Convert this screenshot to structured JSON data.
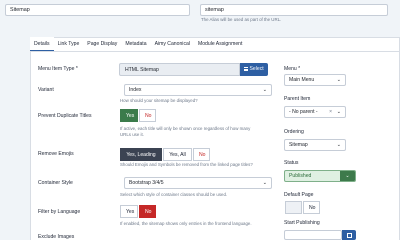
{
  "header": {
    "title_value": "Sitemap",
    "alias_value": "sitemap",
    "alias_note": "The Alias will be used as part of the URL."
  },
  "tabs": [
    "Details",
    "Link Type",
    "Page Display",
    "Metadata",
    "Aimy Canonical",
    "Module Assignment"
  ],
  "fields": {
    "menu_item_type": {
      "label": "Menu Item Type *",
      "value": "HTML Sitemap",
      "button": "Select"
    },
    "variant": {
      "label": "Variant",
      "value": "Index",
      "hint": "How should your sitemap be displayed?"
    },
    "prevent_duplicate": {
      "label": "Prevent Duplicate Titles",
      "yes": "Yes",
      "no": "No",
      "hint": "If active, each title will only be shown once regardless of how many URLs use it."
    },
    "remove_emojis": {
      "label": "Remove Emojis",
      "opt1": "Yes, Leading",
      "opt2": "Yes, All",
      "opt3": "No",
      "hint": "Should Emojis and Symbols be removed from the linked page titles?"
    },
    "container_style": {
      "label": "Container Style",
      "value": "Bootstrap 3/4/5",
      "hint": "Select which style of container classes should be used."
    },
    "filter_language": {
      "label": "Filter by Language",
      "yes": "Yes",
      "no": "No",
      "hint": "If enabled, the sitemap shows only entries in the frontend language."
    },
    "exclude_images": {
      "label": "Exclude Images"
    }
  },
  "sidebar": {
    "menu": {
      "label": "Menu *",
      "value": "Main Menu"
    },
    "parent_item": {
      "label": "Parent Item",
      "value": "- No parent -"
    },
    "ordering": {
      "label": "Ordering",
      "value": "Sitemap"
    },
    "status": {
      "label": "Status",
      "value": "Published"
    },
    "default_page": {
      "label": "Default Page",
      "value": "No"
    },
    "start_publishing": {
      "label": "Start Publishing"
    }
  },
  "colors": {
    "accent": "#2e5fa3",
    "green": "#3b7b4b",
    "red": "#c52827",
    "dark": "#3b4352"
  }
}
